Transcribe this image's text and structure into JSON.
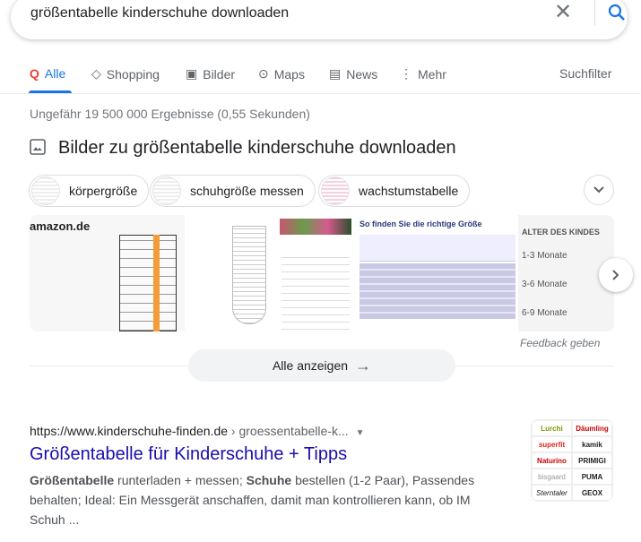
{
  "search": {
    "query": "größentabelle kinderschuhe downloaden"
  },
  "tabs": [
    {
      "label": "Alle",
      "icon": "google-search-icon"
    },
    {
      "label": "Shopping",
      "icon": "tag-icon"
    },
    {
      "label": "Bilder",
      "icon": "image-icon"
    },
    {
      "label": "Maps",
      "icon": "map-pin-icon"
    },
    {
      "label": "News",
      "icon": "news-icon"
    },
    {
      "label": "Mehr",
      "icon": "more-vert-icon"
    }
  ],
  "tools_label": "Suchfilter",
  "stats": "Ungefähr 19 500 000 Ergebnisse (0,55 Sekunden)",
  "images": {
    "heading": "Bilder zu größentabelle kinderschuhe downloaden",
    "chips": [
      "körpergröße",
      "schuhgröße messen",
      "wachstumstabelle"
    ],
    "thumb_texts": {
      "t1": "amazon.de",
      "t4": "So finden Sie die richtige Größe",
      "t5_head": "ALTER DES KINDES",
      "t5_rows": [
        "1-3 Monate",
        "3-6 Monate",
        "6-9 Monate"
      ]
    },
    "feedback": "Feedback geben",
    "show_all": "Alle anzeigen"
  },
  "result": {
    "url": "https://www.kinderschuhe-finden.de",
    "crumb": " › groessentabelle-k...",
    "title": "Größentabelle für Kinderschuhe + Tipps",
    "snippet": [
      {
        "b": "Größentabelle"
      },
      {
        "t": " runterladen + messen; "
      },
      {
        "b": "Schuhe"
      },
      {
        "t": " bestellen (1-2 Paar), Passendes behalten; Ideal: Ein Messgerät anschaffen, damit man kontrollieren kann, ob IM Schuh ..."
      }
    ],
    "thumb_logos": [
      "Lurchi",
      "Däumling",
      "superfit",
      "kamik",
      "Naturino",
      "PRIMIGI",
      "bisgaard",
      "PUMA",
      "Sterntaler",
      "GEOX"
    ]
  },
  "colors": {
    "accent": "#1a73e8",
    "link": "#1a0dab"
  }
}
